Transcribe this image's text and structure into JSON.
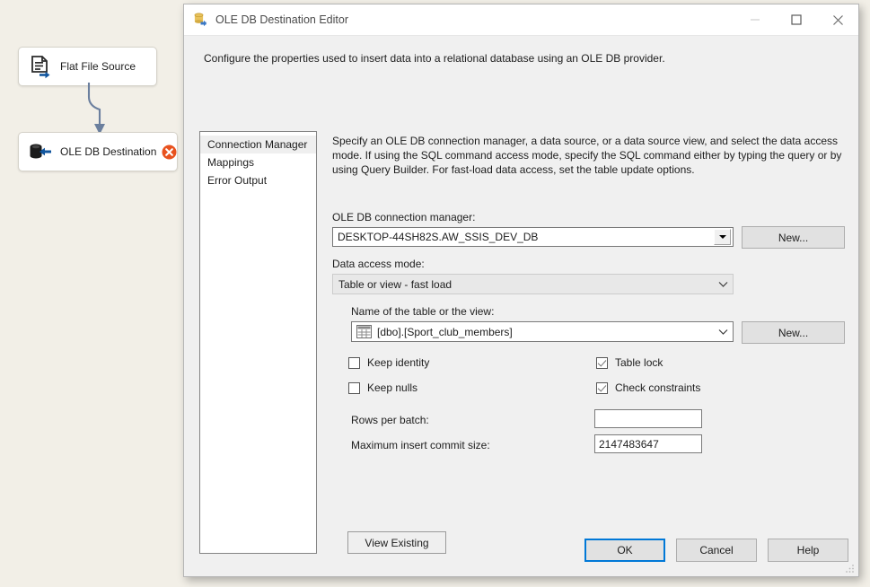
{
  "canvas": {
    "background_color": "#f2efe7",
    "nodes": [
      {
        "id": "flat-file-source",
        "label": "Flat File Source",
        "icon": "flat-file-source-icon"
      },
      {
        "id": "ole-db-destination",
        "label": "OLE DB Destination",
        "icon": "ole-db-destination-icon",
        "badge": "error-badge",
        "badge_color": "#e8521e"
      }
    ],
    "connector": {
      "name": "data-flow-path-arrow",
      "color": "#6b7f9e"
    }
  },
  "dialog": {
    "title": "OLE DB Destination Editor",
    "title_icon": "ole-db-destination-editor-icon",
    "window_controls": {
      "minimize": "minimize-icon",
      "maximize": "maximize-icon",
      "close": "close-icon"
    },
    "description": "Configure the properties used to insert data into a relational database using an OLE DB provider.",
    "page_list": [
      {
        "label": "Connection Manager",
        "selected": true
      },
      {
        "label": "Mappings",
        "selected": false
      },
      {
        "label": "Error Output",
        "selected": false
      }
    ],
    "content": {
      "instructions": "Specify an OLE DB connection manager, a data source, or a data source view, and select the data access mode. If using the SQL command access mode, specify the SQL command either by typing the query or by using Query Builder. For fast-load data access, set the table update options.",
      "connection_manager": {
        "label": "OLE DB connection manager:",
        "value": "DESKTOP-44SH82S.AW_SSIS_DEV_DB",
        "new_button": "New...",
        "dropdown_icon": "chevron-down-icon"
      },
      "data_access_mode": {
        "label": "Data access mode:",
        "value": "Table or view - fast load",
        "dropdown_icon": "chevron-down-icon"
      },
      "table_or_view": {
        "label": "Name of the table or the view:",
        "value": "[dbo].[Sport_club_members]",
        "icon": "table-grid-icon",
        "new_button": "New...",
        "dropdown_icon": "chevron-down-icon"
      },
      "checkboxes": [
        {
          "label": "Keep identity",
          "checked": false
        },
        {
          "label": "Keep nulls",
          "checked": false
        },
        {
          "label": "Table lock",
          "checked": true
        },
        {
          "label": "Check constraints",
          "checked": true
        }
      ],
      "rows_per_batch": {
        "label": "Rows per batch:",
        "value": ""
      },
      "maximum_insert_commit_size": {
        "label": "Maximum insert commit size:",
        "value": "2147483647"
      },
      "view_existing_button": "View Existing"
    },
    "footer": {
      "ok": "OK",
      "cancel": "Cancel",
      "help": "Help",
      "focus_color": "#0078d7"
    }
  }
}
